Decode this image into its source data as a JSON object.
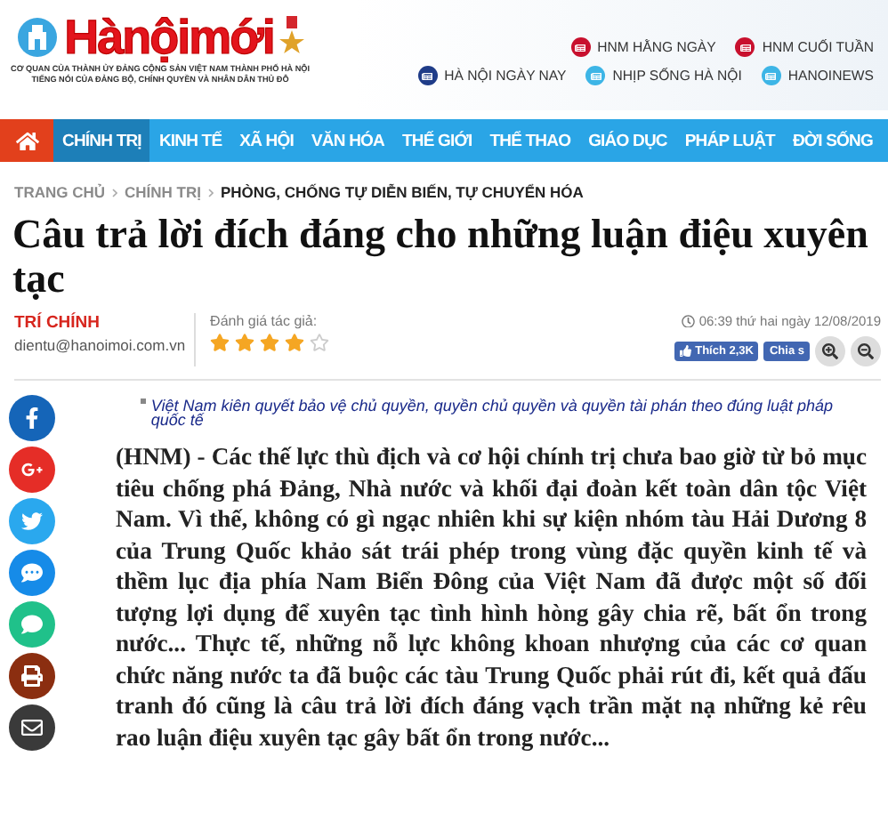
{
  "header": {
    "logo": {
      "name": "Hànộimới",
      "tagline_lines": [
        "CƠ QUAN CỦA THÀNH ỦY ĐẢNG CỘNG SẢN VIỆT NAM THÀNH PHỐ HÀ NỘI",
        "TIẾNG NÓI CỦA ĐẢNG BỘ, CHÍNH QUYỀN VÀ NHÂN DÂN THỦ ĐÔ"
      ]
    },
    "publications": [
      {
        "label": "HNM HẰNG NGÀY",
        "color": "#c8102e"
      },
      {
        "label": "HNM CUỐI TUẦN",
        "color": "#c8102e"
      },
      {
        "label": "HÀ NỘI NGÀY NAY",
        "color": "#1f3c88"
      },
      {
        "label": "NHỊP SỐNG HÀ NỘI",
        "color": "#3db5e6"
      },
      {
        "label": "HANOINEWS",
        "color": "#3db5e6"
      }
    ]
  },
  "nav": {
    "items": [
      {
        "label": "CHÍNH TRỊ",
        "selected": true
      },
      {
        "label": "KINH TẾ",
        "selected": false
      },
      {
        "label": "XÃ HỘI",
        "selected": false
      },
      {
        "label": "VĂN HÓA",
        "selected": false
      },
      {
        "label": "THẾ GIỚI",
        "selected": false
      },
      {
        "label": "THỂ THAO",
        "selected": false
      },
      {
        "label": "GIÁO DỤC",
        "selected": false
      },
      {
        "label": "PHÁP LUẬT",
        "selected": false
      },
      {
        "label": "ĐỜI SỐNG",
        "selected": false
      }
    ]
  },
  "breadcrumb": [
    {
      "label": "TRANG CHỦ",
      "current": false
    },
    {
      "label": "CHÍNH TRỊ",
      "current": false
    },
    {
      "label": "PHÒNG, CHỐNG TỰ DIỄN BIẾN, TỰ CHUYỂN HÓA",
      "current": true
    }
  ],
  "article": {
    "title": "Câu trả lời đích đáng cho những luận điệu xuyên tạc",
    "author": {
      "name": "TRÍ CHÍNH",
      "email": "dientu@hanoimoi.com.vn"
    },
    "rating": {
      "label": "Đánh giá tác giả:",
      "stars": 4
    },
    "date": "06:39 thứ hai ngày 12/08/2019",
    "like_button": "Thích 2,3K",
    "share_button": "Chia s",
    "related": "Việt Nam kiên quyết bảo vệ chủ quyền, quyền chủ quyền và quyền tài phán theo đúng luật pháp quốc tế",
    "body": "(HNM) - Các thế lực thù địch và cơ hội chính trị chưa bao giờ từ bỏ mục tiêu chống phá Đảng, Nhà nước và khối đại đoàn kết toàn dân tộc Việt Nam. Vì thế, không có gì ngạc nhiên khi sự kiện nhóm tàu Hải Dương 8 của Trung Quốc khảo sát trái phép trong vùng đặc quyền kinh tế và thềm lục địa phía Nam Biển Đông của Việt Nam đã được một số đối tượng lợi dụng để xuyên tạc tình hình hòng gây chia rẽ, bất ổn trong nước... Thực tế, những nỗ lực không khoan nhượng của các cơ quan chức năng nước ta đã buộc các tàu Trung Quốc phải rút đi, kết quả đấu tranh đó cũng là câu trả lời đích đáng vạch trần mặt nạ những kẻ rêu rao luận điệu xuyên tạc gây bất ổn trong nước..."
  },
  "share_bar": [
    {
      "kind": "facebook"
    },
    {
      "kind": "googleplus"
    },
    {
      "kind": "twitter"
    },
    {
      "kind": "zalo"
    },
    {
      "kind": "sms"
    },
    {
      "kind": "print"
    },
    {
      "kind": "email"
    }
  ]
}
